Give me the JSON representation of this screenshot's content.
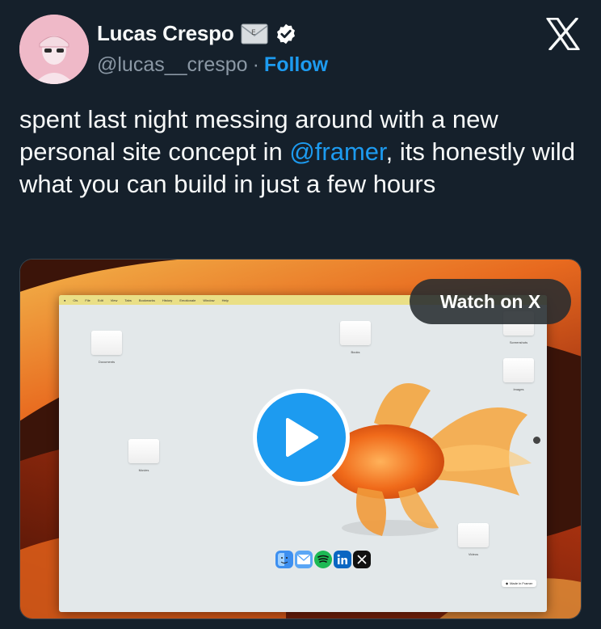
{
  "author": {
    "name": "Lucas Crespo",
    "handle": "@lucas__crespo",
    "separator": "·",
    "follow_label": "Follow"
  },
  "tweet": {
    "text_before_mention": "spent last night messing around with a new personal site concept in ",
    "mention": "@framer",
    "text_after_mention": ", its honestly wild what you can build in just a few hours"
  },
  "media": {
    "watch_label": "Watch on X",
    "menubar_items": [
      "Ois",
      "File",
      "Edit",
      "View",
      "Tabs",
      "Bookmarks",
      "History",
      "Emotionale",
      "Window",
      "Help"
    ],
    "folders": {
      "documents": "Documents",
      "books": "Books",
      "screenshots": "Screenshots",
      "images": "Images",
      "movies": "Movies",
      "videos": "Videos"
    },
    "badge_label": "Made in Framer",
    "dock_apps": [
      "finder-icon",
      "mail-icon",
      "spotify-icon",
      "linkedin-icon",
      "x-icon"
    ]
  },
  "colors": {
    "background": "#15202b",
    "accent": "#1d9bf0",
    "secondary_text": "#8b98a5"
  }
}
